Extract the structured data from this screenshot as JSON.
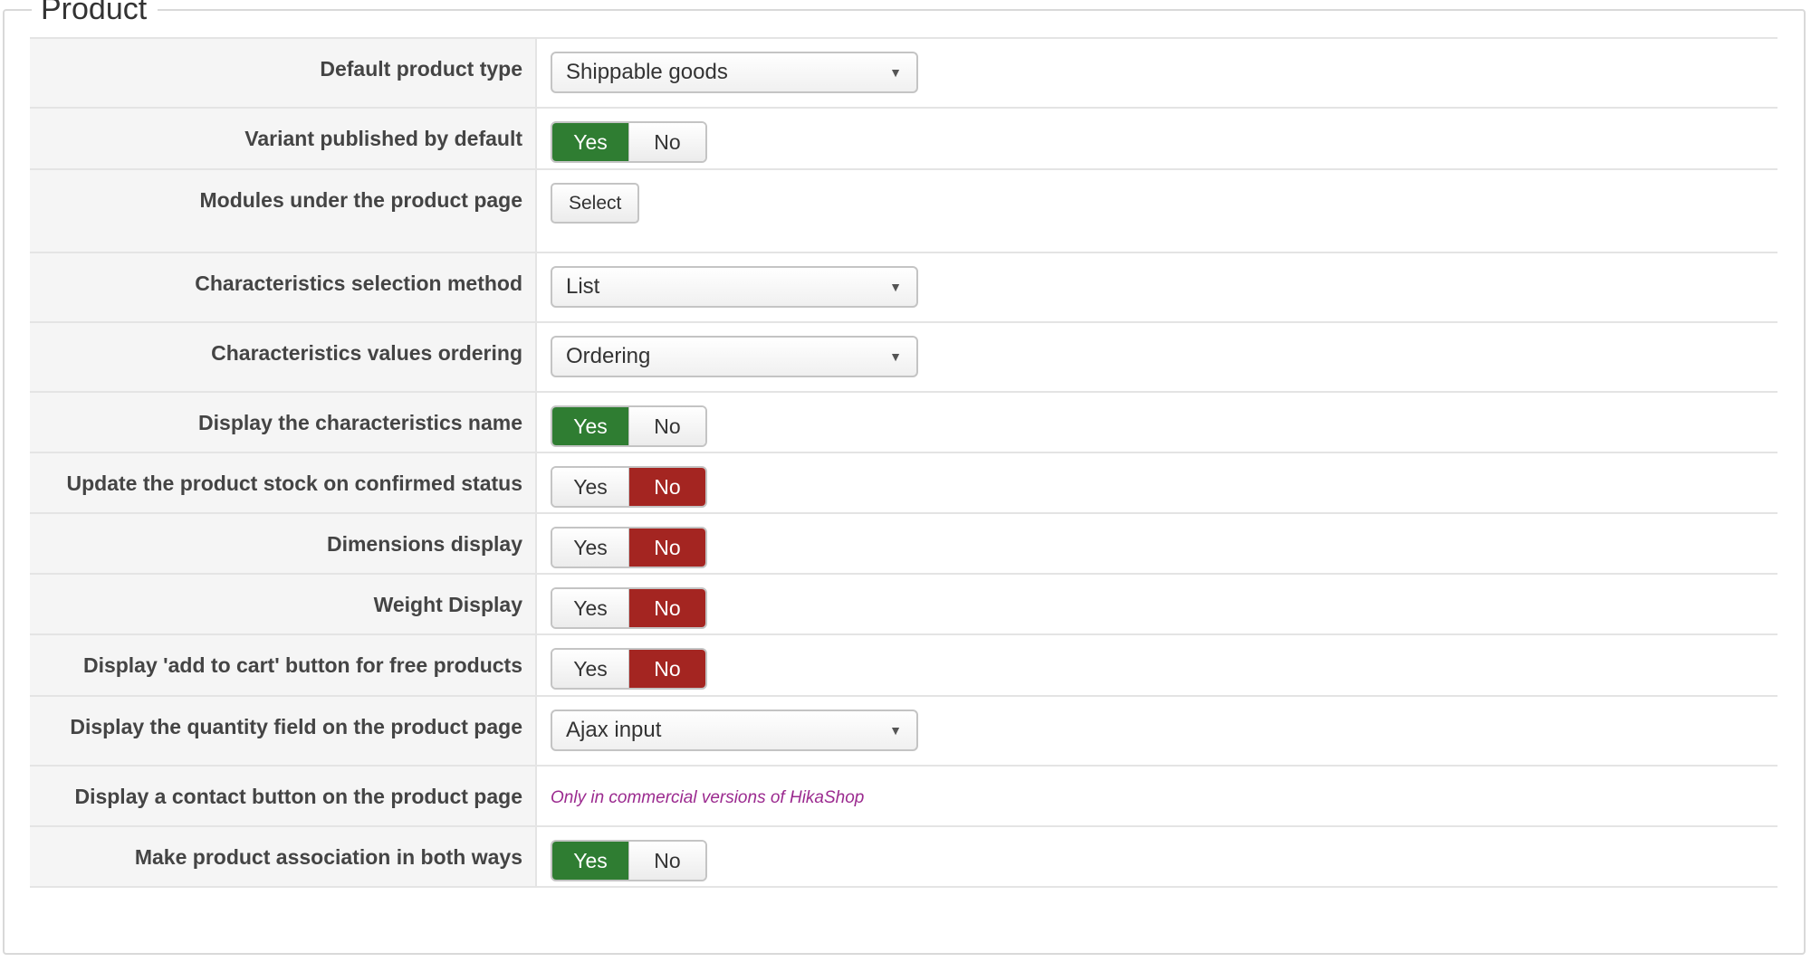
{
  "section": {
    "title": "Product"
  },
  "colors": {
    "yes_active": "#2f7d32",
    "no_active": "#a42521",
    "note_text": "#9b2a8f"
  },
  "rows": [
    {
      "label": "Default product type",
      "control": "select",
      "value": "Shippable goods"
    },
    {
      "label": "Variant published by default",
      "control": "toggle",
      "yes": "Yes",
      "no": "No",
      "selected": "Yes"
    },
    {
      "label": "Modules under the product page",
      "control": "button",
      "button_label": "Select"
    },
    {
      "label": "Characteristics selection method",
      "control": "select",
      "value": "List"
    },
    {
      "label": "Characteristics values ordering",
      "control": "select",
      "value": "Ordering"
    },
    {
      "label": "Display the characteristics name",
      "control": "toggle",
      "yes": "Yes",
      "no": "No",
      "selected": "Yes"
    },
    {
      "label": "Update the product stock on confirmed status",
      "control": "toggle",
      "yes": "Yes",
      "no": "No",
      "selected": "No"
    },
    {
      "label": "Dimensions display",
      "control": "toggle",
      "yes": "Yes",
      "no": "No",
      "selected": "No"
    },
    {
      "label": "Weight Display",
      "control": "toggle",
      "yes": "Yes",
      "no": "No",
      "selected": "No"
    },
    {
      "label": "Display 'add to cart' button for free products",
      "control": "toggle",
      "yes": "Yes",
      "no": "No",
      "selected": "No"
    },
    {
      "label": "Display the quantity field on the product page",
      "control": "select",
      "value": "Ajax input"
    },
    {
      "label": "Display a contact button on the product page",
      "control": "note",
      "note": "Only in commercial versions of HikaShop"
    },
    {
      "label": "Make product association in both ways",
      "control": "toggle",
      "yes": "Yes",
      "no": "No",
      "selected": "Yes"
    }
  ]
}
